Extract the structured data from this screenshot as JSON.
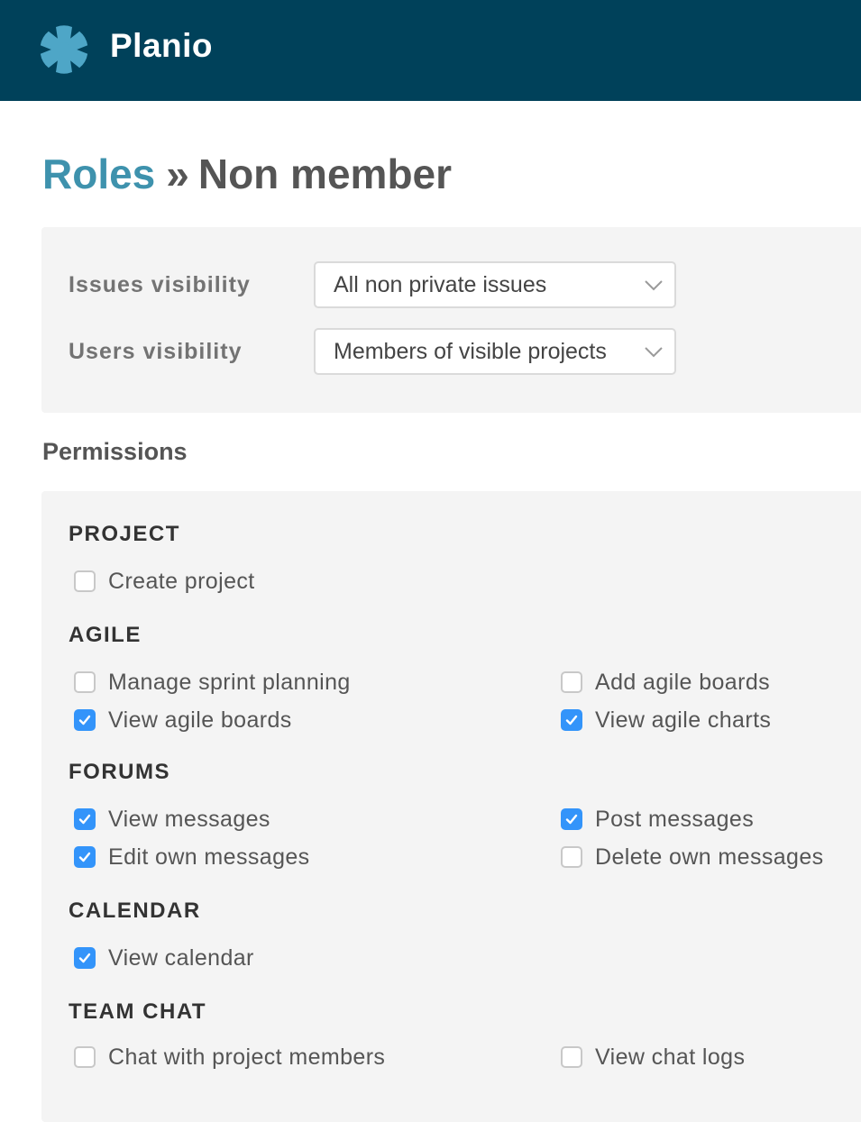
{
  "header": {
    "brand": "Planio",
    "logo_icon": "asterisk-icon",
    "background": "#00415a",
    "logo_color": "#4ea6c7"
  },
  "page": {
    "breadcrumb_link": "Roles",
    "separator": "»",
    "title": "Non member"
  },
  "visibility": {
    "issues_label": "Issues visibility",
    "issues_value": "All non private issues",
    "users_label": "Users visibility",
    "users_value": "Members of visible projects"
  },
  "permissions": {
    "title": "Permissions",
    "check_color": "#3394fa",
    "sections": [
      {
        "title": "PROJECT",
        "items": [
          {
            "label": "Create project",
            "checked": false
          }
        ]
      },
      {
        "title": "AGILE",
        "items": [
          {
            "label": "Manage sprint planning",
            "checked": false
          },
          {
            "label": "Add agile boards",
            "checked": false
          },
          {
            "label": "View agile boards",
            "checked": true
          },
          {
            "label": "View agile charts",
            "checked": true
          }
        ]
      },
      {
        "title": "FORUMS",
        "items": [
          {
            "label": "View messages",
            "checked": true
          },
          {
            "label": "Post messages",
            "checked": true
          },
          {
            "label": "Edit own messages",
            "checked": true
          },
          {
            "label": "Delete own messages",
            "checked": false
          }
        ]
      },
      {
        "title": "CALENDAR",
        "items": [
          {
            "label": "View calendar",
            "checked": true
          }
        ]
      },
      {
        "title": "TEAM CHAT",
        "items": [
          {
            "label": "Chat with project members",
            "checked": false
          },
          {
            "label": "View chat logs",
            "checked": false
          }
        ]
      }
    ]
  }
}
